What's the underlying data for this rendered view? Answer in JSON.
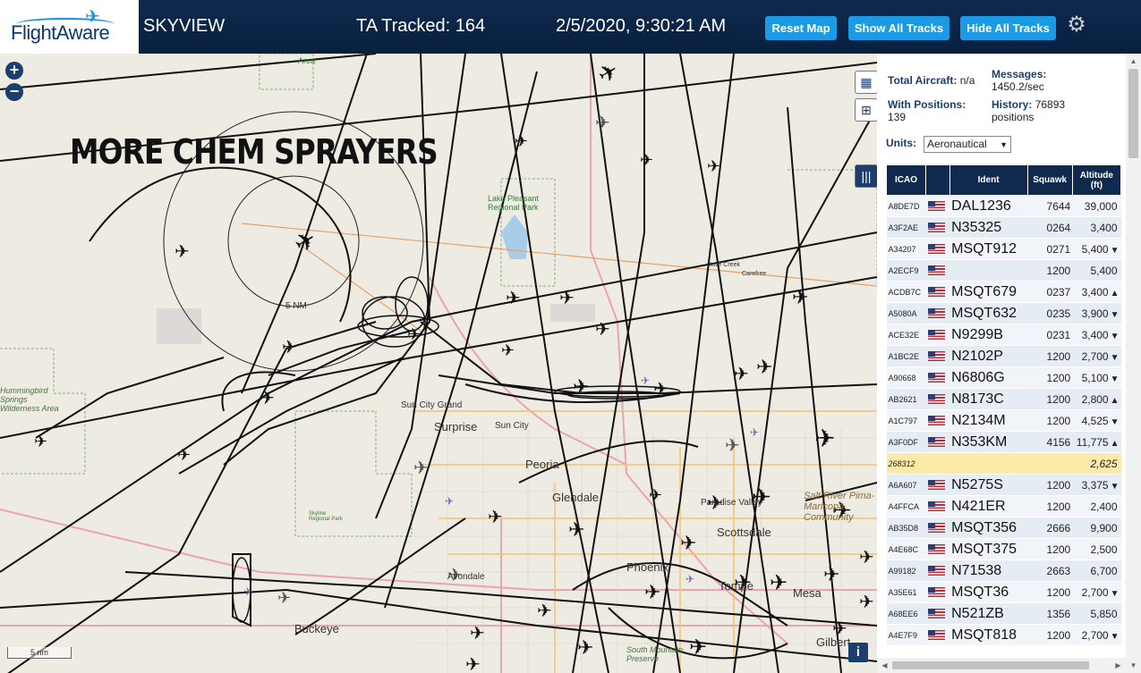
{
  "header": {
    "logo_text": "FlightAware",
    "app_name": "SKYVIEW",
    "ta_tracked": "TA Tracked: 164",
    "datetime": "2/5/2020, 9:30:21 AM",
    "buttons": {
      "reset": "Reset Map",
      "show_all": "Show All Tracks",
      "hide_all": "Hide All Tracks"
    },
    "settings_icon": "gear-icon"
  },
  "map": {
    "overlay_title": "MORE CHEM SPRAYERS",
    "range_ring_label": "5 NM",
    "scale_label": "5 nm",
    "zoom_in": "+",
    "zoom_out": "−",
    "info_label": "i",
    "places": [
      {
        "name": "Peoria",
        "kind": "city"
      },
      {
        "name": "Glendale",
        "kind": "city"
      },
      {
        "name": "Surprise",
        "kind": "city"
      },
      {
        "name": "Sun City",
        "kind": "small"
      },
      {
        "name": "Sun City Grand",
        "kind": "small"
      },
      {
        "name": "Scottsdale",
        "kind": "city"
      },
      {
        "name": "Phoenix",
        "kind": "city"
      },
      {
        "name": "Tempe",
        "kind": "city"
      },
      {
        "name": "Mesa",
        "kind": "city"
      },
      {
        "name": "Gilbert",
        "kind": "city"
      },
      {
        "name": "Buckeye",
        "kind": "city"
      },
      {
        "name": "Avondale",
        "kind": "small"
      },
      {
        "name": "Paradise Valley",
        "kind": "small"
      },
      {
        "name": "Salt River Pima-Maricopa Community",
        "kind": "small"
      },
      {
        "name": "Cave Creek",
        "kind": "small"
      },
      {
        "name": "Carefree",
        "kind": "small"
      },
      {
        "name": "Lake Pleasant Regional Park",
        "kind": "park"
      },
      {
        "name": "Hummingbird Springs Wilderness Area",
        "kind": "park"
      },
      {
        "name": "Skyline Regional Park",
        "kind": "park"
      },
      {
        "name": "South Mountain Preserve",
        "kind": "park"
      },
      {
        "name": "Area",
        "kind": "park"
      }
    ]
  },
  "sidebar": {
    "total_aircraft_label": "Total Aircraft:",
    "total_aircraft_value": "n/a",
    "messages_label": "Messages:",
    "messages_value": "1450.2/sec",
    "with_positions_label": "With Positions:",
    "with_positions_value": "139",
    "history_label": "History:",
    "history_value": "76893",
    "history_unit": "positions",
    "units_label": "Units:",
    "units_value": "Aeronautical",
    "columns": [
      "ICAO",
      "",
      "Ident",
      "Squawk",
      "Altitude (ft)"
    ],
    "rows": [
      {
        "icao": "A8DE7D",
        "flag": true,
        "ident": "DAL1236",
        "squawk": "7644",
        "alt": "39,000",
        "trend": ""
      },
      {
        "icao": "A3F2AE",
        "flag": true,
        "ident": "N35325",
        "squawk": "0264",
        "alt": "3,400",
        "trend": ""
      },
      {
        "icao": "A34207",
        "flag": true,
        "ident": "MSQT912",
        "squawk": "0271",
        "alt": "5,400",
        "trend": "▼"
      },
      {
        "icao": "A2ECF9",
        "flag": true,
        "ident": "",
        "squawk": "1200",
        "alt": "5,400",
        "trend": ""
      },
      {
        "icao": "ACDB7C",
        "flag": true,
        "ident": "MSQT679",
        "squawk": "0237",
        "alt": "3,400",
        "trend": "▲"
      },
      {
        "icao": "A5080A",
        "flag": true,
        "ident": "MSQT632",
        "squawk": "0235",
        "alt": "3,900",
        "trend": "▼"
      },
      {
        "icao": "ACE32E",
        "flag": true,
        "ident": "N9299B",
        "squawk": "0231",
        "alt": "3,400",
        "trend": "▼"
      },
      {
        "icao": "A1BC2E",
        "flag": true,
        "ident": "N2102P",
        "squawk": "1200",
        "alt": "2,700",
        "trend": "▼"
      },
      {
        "icao": "A90668",
        "flag": true,
        "ident": "N6806G",
        "squawk": "1200",
        "alt": "5,100",
        "trend": "▼"
      },
      {
        "icao": "AB2621",
        "flag": true,
        "ident": "N8173C",
        "squawk": "1200",
        "alt": "2,800",
        "trend": "▲"
      },
      {
        "icao": "A1C797",
        "flag": true,
        "ident": "N2134M",
        "squawk": "1200",
        "alt": "4,525",
        "trend": "▼"
      },
      {
        "icao": "A3F0DF",
        "flag": true,
        "ident": "N353KM",
        "squawk": "4156",
        "alt": "11,775",
        "trend": "▲"
      },
      {
        "icao": "268312",
        "flag": false,
        "ident": "",
        "squawk": "",
        "alt": "2,625",
        "trend": "",
        "highlight": true
      },
      {
        "icao": "A6A607",
        "flag": true,
        "ident": "N5275S",
        "squawk": "1200",
        "alt": "3,375",
        "trend": "▼"
      },
      {
        "icao": "A4FFCA",
        "flag": true,
        "ident": "N421ER",
        "squawk": "1200",
        "alt": "2,400",
        "trend": ""
      },
      {
        "icao": "AB35D8",
        "flag": true,
        "ident": "MSQT356",
        "squawk": "2666",
        "alt": "9,900",
        "trend": ""
      },
      {
        "icao": "A4E68C",
        "flag": true,
        "ident": "MSQT375",
        "squawk": "1200",
        "alt": "2,500",
        "trend": ""
      },
      {
        "icao": "A99182",
        "flag": true,
        "ident": "N71538",
        "squawk": "2663",
        "alt": "6,700",
        "trend": ""
      },
      {
        "icao": "A35E61",
        "flag": true,
        "ident": "MSQT36",
        "squawk": "1200",
        "alt": "2,700",
        "trend": "▼"
      },
      {
        "icao": "A68EE6",
        "flag": true,
        "ident": "N521ZB",
        "squawk": "1356",
        "alt": "5,850",
        "trend": ""
      },
      {
        "icao": "A4E7F9",
        "flag": true,
        "ident": "MSQT818",
        "squawk": "1200",
        "alt": "2,700",
        "trend": "▼"
      }
    ]
  }
}
